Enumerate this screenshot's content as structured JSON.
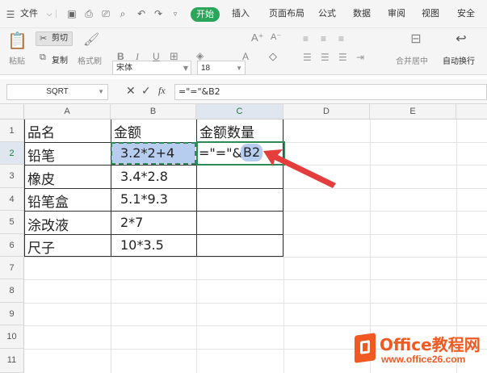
{
  "menubar": {
    "file": "文件",
    "tabs": [
      "开始",
      "插入",
      "页面布局",
      "公式",
      "数据",
      "审阅",
      "视图",
      "安全"
    ]
  },
  "ribbon": {
    "paste": "粘贴",
    "cut": "剪切",
    "copy": "复制",
    "format_painter": "格式刷",
    "font_name": "宋体",
    "font_size": "18",
    "merge_center": "合并居中",
    "wrap_text": "自动换行"
  },
  "formula_bar": {
    "name_box": "SQRT",
    "fx": "fx",
    "formula": "=\"=\"&B2"
  },
  "sheet": {
    "columns": [
      "A",
      "B",
      "C",
      "D",
      "E"
    ],
    "rows": [
      "1",
      "2",
      "3",
      "4",
      "5",
      "6",
      "7",
      "8",
      "9",
      "10",
      "11"
    ],
    "cells": {
      "A1": "品名",
      "B1": "金额",
      "C1": "金额数量",
      "A2": "铅笔",
      "B2": "3.2*2+4",
      "C2_prefix": "=\"=\"&",
      "C2_ref": "B2",
      "A3": "橡皮",
      "B3": "3.4*2.8",
      "A4": "铅笔盒",
      "B4": "5.1*9.3",
      "A5": "涂改液",
      "B5": "2*7",
      "A6": "尺子",
      "B6": "10*3.5"
    }
  },
  "watermark": {
    "brand": "Office教程网",
    "url": "www.office26.com"
  },
  "colors": {
    "accent_green": "#2aa55a",
    "arrow_red": "#e53c3c",
    "selection_blue": "#b7cdf0",
    "brand_orange": "#f05a22"
  }
}
